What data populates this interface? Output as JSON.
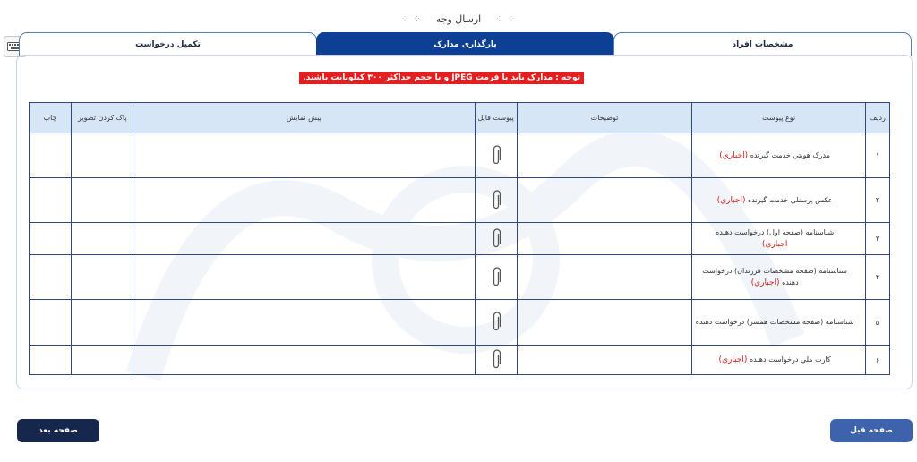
{
  "header": {
    "title": "ارسال وجه",
    "decoration": "⁘ ⁘"
  },
  "tabs": [
    {
      "label": "مشخصات افراد",
      "active": false
    },
    {
      "label": "بارگذاری مدارک",
      "active": true
    },
    {
      "label": "تکمیل درخواست",
      "active": false
    }
  ],
  "notice": "توجه : مدارک باید با فرمت JPEG و با حجم حداکثر ۳۰۰ کیلوبایت باشند.",
  "table": {
    "columns": [
      "ردیف",
      "نوع پیوست",
      "توضیحات",
      "پیوست فایل",
      "پیش نمایش",
      "پاک کردن تصویر",
      "چاپ"
    ],
    "rows": [
      {
        "num": "۱",
        "type": "مدرک هویتي خدمت گيرنده",
        "required": "(اجباري)"
      },
      {
        "num": "۲",
        "type": "عکس پرسنلي خدمت گيرنده",
        "required": "(اجباري)"
      },
      {
        "num": "۳",
        "type": "شناسنامه (صفحه اول) درخواست دهنده",
        "required": "اجباري)"
      },
      {
        "num": "۴",
        "type": "شناسنامه (صفحه مشخصات فرزندان) درخواست دهنده",
        "required": "(اجباري)"
      },
      {
        "num": "۵",
        "type": "شناسنامه (صفحه مشخصات همسر) درخواست دهنده",
        "required": ""
      },
      {
        "num": "۶",
        "type": "کارت ملي درخواست دهنده",
        "required": "(اجباري)"
      }
    ]
  },
  "buttons": {
    "next": "صفحه بعد",
    "prev": "صفحه قبل"
  },
  "colors": {
    "primary": "#0d3f94",
    "notice": "#e51f1f",
    "header_bg": "#d7e6f7",
    "required": "#d01c1c"
  },
  "icons": {
    "attach": "paperclip-icon",
    "keyboard": "keyboard-icon"
  }
}
